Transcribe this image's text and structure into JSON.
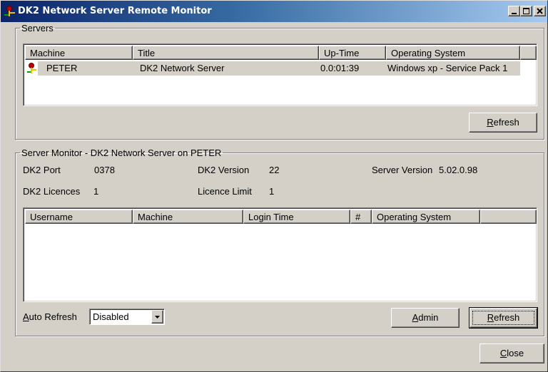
{
  "window": {
    "title": "DK2 Network Server Remote Monitor",
    "icon": "dk2-server-icon"
  },
  "servers_group": {
    "legend": "Servers",
    "columns": [
      "Machine",
      "Title",
      "Up-Time",
      "Operating System"
    ],
    "rows": [
      {
        "machine": "PETER",
        "title": "DK2 Network Server",
        "uptime": "0.0:01:39",
        "os": "Windows xp - Service Pack 1",
        "icon": "server-machine-icon",
        "selected": true
      }
    ],
    "refresh_label_accel": "R",
    "refresh_label_rest": "efresh"
  },
  "monitor_group": {
    "legend": "Server Monitor - DK2 Network Server on PETER",
    "dk2_port_label": "DK2 Port",
    "dk2_port_value": "0378",
    "dk2_version_label": "DK2 Version",
    "dk2_version_value": "22",
    "server_version_label": "Server Version",
    "server_version_value": "5.02.0.98",
    "licences_label": "DK2 Licences",
    "licences_value": "1",
    "licence_limit_label": "Licence Limit",
    "licence_limit_value": "1",
    "columns": [
      "Username",
      "Machine",
      "Login Time",
      "#",
      "Operating System"
    ],
    "rows": [],
    "auto_refresh_label_accel": "A",
    "auto_refresh_label_rest": "uto Refresh",
    "auto_refresh_value": "Disabled",
    "admin_label_accel": "A",
    "admin_label_rest": "dmin",
    "refresh_label_accel": "R",
    "refresh_label_rest": "efresh"
  },
  "footer": {
    "close_label_accel": "C",
    "close_label_rest": "lose"
  },
  "colors": {
    "titlebar_start": "#0a246a",
    "titlebar_end": "#a6caf0",
    "selection": "#d4d0c8",
    "face": "#d4d0c8"
  }
}
